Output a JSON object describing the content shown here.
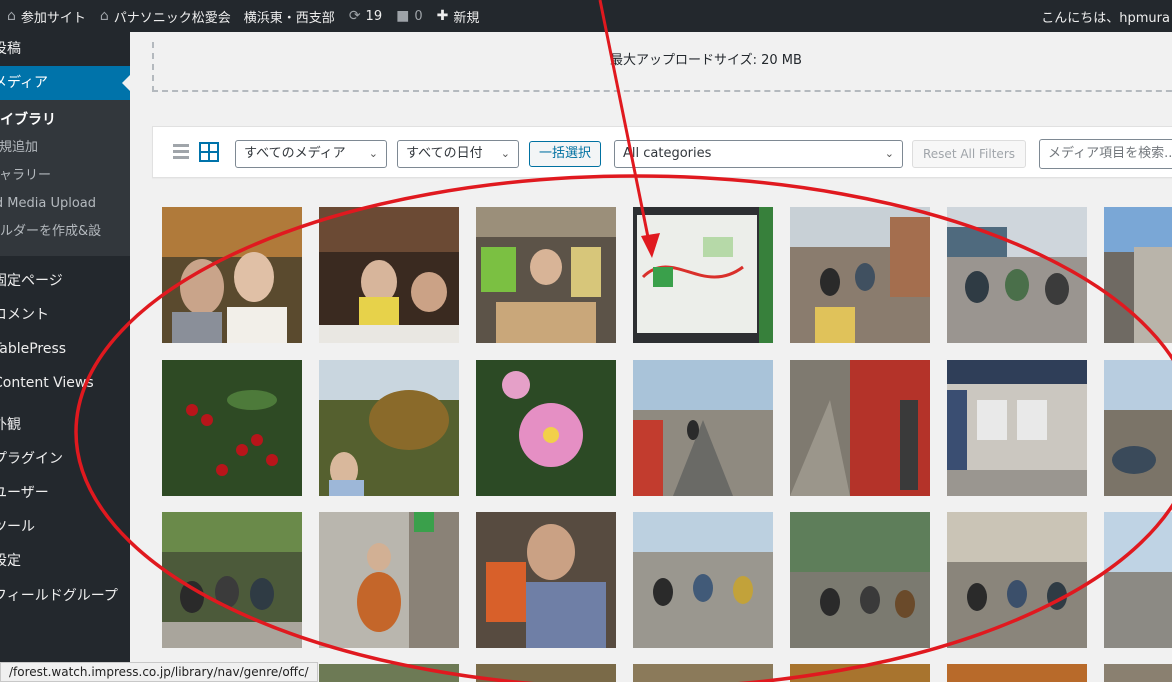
{
  "adminbar": {
    "site_icon": "house-cluster-icon",
    "site": "参加サイト",
    "home_icon": "house-icon",
    "org": "パナソニック松愛会　横浜東・西支部",
    "updates_icon": "refresh-icon",
    "updates": "19",
    "comments_icon": "comment-icon",
    "comments": "0",
    "new_icon": "plus-icon",
    "new": "新規",
    "greeting": "こんにちは、hpmura"
  },
  "sidebar": {
    "posts": "投稿",
    "media": "メディア",
    "sub": {
      "library": "ライブラリ",
      "add": "新規追加",
      "gallery": "ギャラリー",
      "folder_upload": "Add Media Upload",
      "folder": "フォルダーを作成&設"
    },
    "pages": "固定ページ",
    "comments": "コメント",
    "tablepress": "TablePress",
    "content_views": "Content Views",
    "appearance": "外観",
    "plugins": "プラグイン",
    "users": "ユーザー",
    "tools": "ツール",
    "settings": "設定",
    "field_groups": "フィールドグループ"
  },
  "upload": {
    "max_size": "最大アップロードサイズ: 20 MB"
  },
  "toolbar": {
    "list_view_icon": "list-view-icon",
    "grid_view_icon": "grid-view-icon",
    "media_filter": "すべてのメディア",
    "date_filter": "すべての日付",
    "bulk_select": "一括選択",
    "category": "All categories",
    "reset": "Reset All Filters",
    "search_placeholder": "メディア項目を検索..."
  },
  "colors": {
    "admin_bg": "#23282d",
    "accent": "#0073aa",
    "annotation": "#e0191f"
  },
  "statusbar": {
    "url": "/forest.watch.impress.co.jp/library/nav/genre/offc/"
  }
}
